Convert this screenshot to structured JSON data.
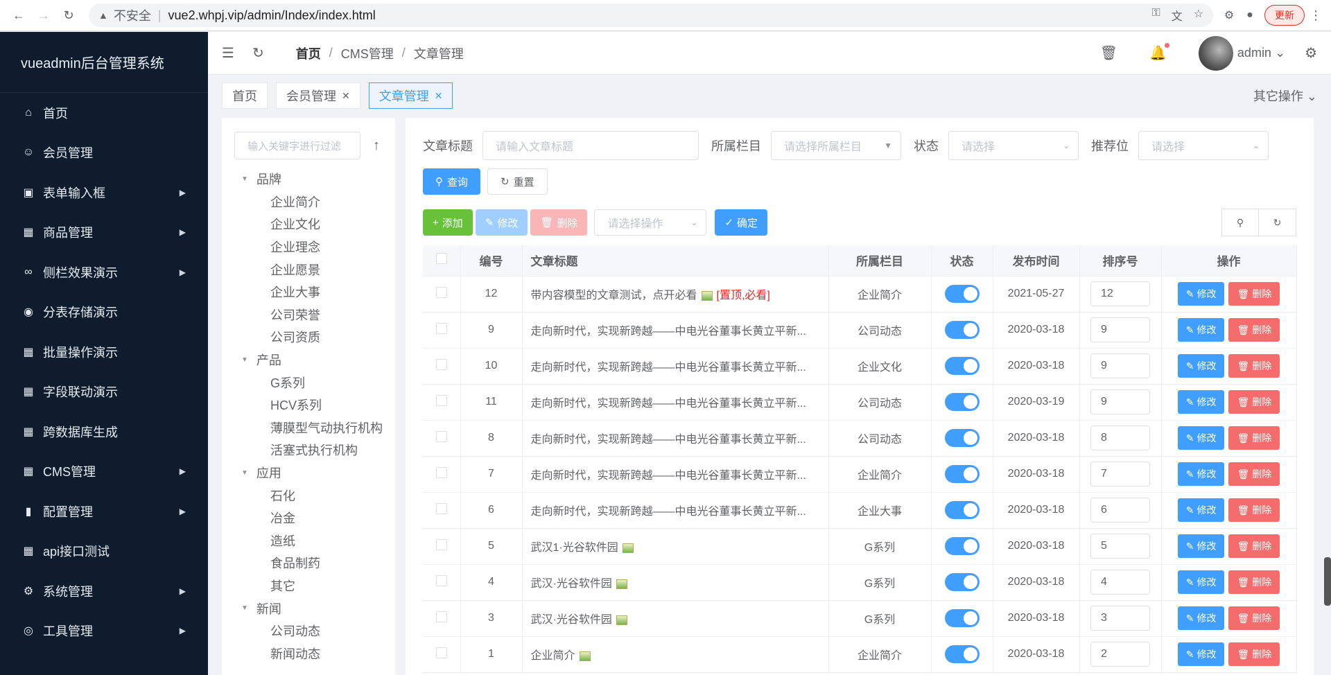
{
  "browser": {
    "insecure_label": "不安全",
    "url": "vue2.whpj.vip/admin/Index/index.html",
    "update_label": "更新"
  },
  "sidebar": {
    "brand": "vueadmin后台管理系统",
    "items": [
      {
        "label": "首页",
        "icon": "home-icon",
        "arrow": false
      },
      {
        "label": "会员管理",
        "icon": "user-icon",
        "arrow": false
      },
      {
        "label": "表单输入框",
        "icon": "briefcase-icon",
        "arrow": true
      },
      {
        "label": "商品管理",
        "icon": "shop-icon",
        "arrow": true
      },
      {
        "label": "侧栏效果演示",
        "icon": "link-icon",
        "arrow": true
      },
      {
        "label": "分表存储演示",
        "icon": "target-icon",
        "arrow": false
      },
      {
        "label": "批量操作演示",
        "icon": "grid-icon",
        "arrow": false
      },
      {
        "label": "字段联动演示",
        "icon": "grid-icon",
        "arrow": false
      },
      {
        "label": "跨数据库生成",
        "icon": "grid-icon",
        "arrow": false
      },
      {
        "label": "CMS管理",
        "icon": "grid-icon",
        "arrow": true
      },
      {
        "label": "配置管理",
        "icon": "bar-chart-icon",
        "arrow": true
      },
      {
        "label": "api接口测试",
        "icon": "grid-icon",
        "arrow": false
      },
      {
        "label": "系统管理",
        "icon": "gear-icon",
        "arrow": true
      },
      {
        "label": "工具管理",
        "icon": "lifebuoy-icon",
        "arrow": true
      }
    ]
  },
  "topbar": {
    "breadcrumbs": [
      "首页",
      "CMS管理",
      "文章管理"
    ],
    "user": "admin"
  },
  "tags": {
    "items": [
      {
        "label": "首页",
        "closable": false,
        "active": false
      },
      {
        "label": "会员管理",
        "closable": true,
        "active": false
      },
      {
        "label": "文章管理",
        "closable": true,
        "active": true
      }
    ],
    "other_ops": "其它操作"
  },
  "tree": {
    "search_placeholder": "输入关键字进行过滤",
    "groups": [
      {
        "label": "品牌",
        "children": [
          "企业简介",
          "企业文化",
          "企业理念",
          "企业愿景",
          "企业大事",
          "公司荣誉",
          "公司资质"
        ]
      },
      {
        "label": "产品",
        "children": [
          "G系列",
          "HCV系列",
          "薄膜型气动执行机构",
          "活塞式执行机构"
        ]
      },
      {
        "label": "应用",
        "children": [
          "石化",
          "冶金",
          "造纸",
          "食品制药",
          "其它"
        ]
      },
      {
        "label": "新闻",
        "children": [
          "公司动态",
          "新闻动态"
        ]
      }
    ]
  },
  "filters": {
    "title_label": "文章标题",
    "title_placeholder": "请输入文章标题",
    "column_label": "所属栏目",
    "column_placeholder": "请选择所属栏目",
    "status_label": "状态",
    "status_placeholder": "请选择",
    "position_label": "推荐位",
    "position_placeholder": "请选择",
    "search_btn": "查询",
    "reset_btn": "重置"
  },
  "toolbar": {
    "add": "添加",
    "edit": "修改",
    "delete": "删除",
    "op_placeholder": "请选择操作",
    "confirm": "确定"
  },
  "table": {
    "headers": [
      "编号",
      "文章标题",
      "所属栏目",
      "状态",
      "发布时间",
      "排序号",
      "操作"
    ],
    "edit_label": "修改",
    "delete_label": "删除",
    "rows": [
      {
        "id": "12",
        "title": "带内容模型的文章测试，点开必看",
        "img": true,
        "tag": "[置顶,必看]",
        "column": "企业简介",
        "date": "2021-05-27",
        "sort": "12"
      },
      {
        "id": "9",
        "title": "走向新时代，实现新跨越——中电光谷董事长黄立平新...",
        "img": false,
        "tag": "",
        "column": "公司动态",
        "date": "2020-03-18",
        "sort": "9"
      },
      {
        "id": "10",
        "title": "走向新时代，实现新跨越——中电光谷董事长黄立平新...",
        "img": false,
        "tag": "",
        "column": "企业文化",
        "date": "2020-03-18",
        "sort": "9"
      },
      {
        "id": "11",
        "title": "走向新时代，实现新跨越——中电光谷董事长黄立平新...",
        "img": false,
        "tag": "",
        "column": "公司动态",
        "date": "2020-03-19",
        "sort": "9"
      },
      {
        "id": "8",
        "title": "走向新时代，实现新跨越——中电光谷董事长黄立平新...",
        "img": false,
        "tag": "",
        "column": "公司动态",
        "date": "2020-03-18",
        "sort": "8"
      },
      {
        "id": "7",
        "title": "走向新时代，实现新跨越——中电光谷董事长黄立平新...",
        "img": false,
        "tag": "",
        "column": "企业简介",
        "date": "2020-03-18",
        "sort": "7"
      },
      {
        "id": "6",
        "title": "走向新时代，实现新跨越——中电光谷董事长黄立平新...",
        "img": false,
        "tag": "",
        "column": "企业大事",
        "date": "2020-03-18",
        "sort": "6"
      },
      {
        "id": "5",
        "title": "武汉1·光谷软件园",
        "img": true,
        "tag": "",
        "column": "G系列",
        "date": "2020-03-18",
        "sort": "5"
      },
      {
        "id": "4",
        "title": "武汉·光谷软件园",
        "img": true,
        "tag": "",
        "column": "G系列",
        "date": "2020-03-18",
        "sort": "4"
      },
      {
        "id": "3",
        "title": "武汉·光谷软件园",
        "img": true,
        "tag": "",
        "column": "G系列",
        "date": "2020-03-18",
        "sort": "3"
      },
      {
        "id": "1",
        "title": "企业简介",
        "img": true,
        "tag": "",
        "column": "企业简介",
        "date": "2020-03-18",
        "sort": "2"
      }
    ]
  }
}
